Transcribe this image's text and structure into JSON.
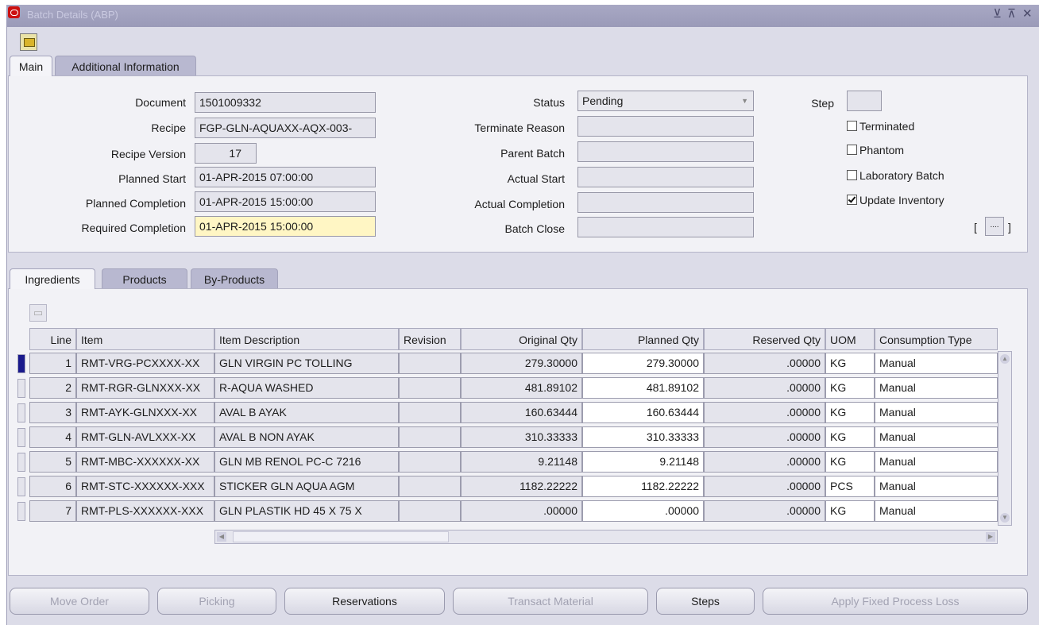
{
  "window": {
    "title": "Batch Details (ABP)",
    "controls": [
      "⊻",
      "⊼",
      "✕"
    ]
  },
  "top_tabs": [
    "Main",
    "Additional Information"
  ],
  "header": {
    "document_label": "Document",
    "document_value": "1501009332",
    "recipe_label": "Recipe",
    "recipe_value": "FGP-GLN-AQUAXX-AQX-003-",
    "recipe_version_label": "Recipe Version",
    "recipe_version_value": "17",
    "planned_start_label": "Planned Start",
    "planned_start_value": "01-APR-2015 07:00:00",
    "planned_completion_label": "Planned Completion",
    "planned_completion_value": "01-APR-2015 15:00:00",
    "required_completion_label": "Required Completion",
    "required_completion_value": "01-APR-2015 15:00:00",
    "status_label": "Status",
    "status_value": "Pending",
    "terminate_reason_label": "Terminate Reason",
    "terminate_reason_value": "",
    "parent_batch_label": "Parent Batch",
    "parent_batch_value": "",
    "actual_start_label": "Actual Start",
    "actual_start_value": "",
    "actual_completion_label": "Actual Completion",
    "actual_completion_value": "",
    "batch_close_label": "Batch Close",
    "batch_close_value": "",
    "step_label": "Step",
    "step_value": "",
    "terminated_label": "Terminated",
    "terminated_checked": false,
    "phantom_label": "Phantom",
    "phantom_checked": false,
    "laboratory_batch_label": "Laboratory Batch",
    "laboratory_batch_checked": false,
    "update_inventory_label": "Update Inventory",
    "update_inventory_checked": true,
    "descflex_open": "[",
    "descflex_value": "....",
    "descflex_close": "]"
  },
  "lower_tabs": [
    "Ingredients",
    "Products",
    "By-Products"
  ],
  "table": {
    "columns": [
      "Line",
      "Item",
      "Item Description",
      "Revision",
      "Original Qty",
      "Planned Qty",
      "Reserved Qty",
      "UOM",
      "Consumption Type"
    ],
    "rows": [
      {
        "line": "1",
        "item": "RMT-VRG-PCXXXX-XX",
        "desc": "GLN VIRGIN PC TOLLING",
        "revision": "",
        "original": "279.30000",
        "planned": "279.30000",
        "reserved": ".00000",
        "uom": "KG",
        "consumption": "Manual"
      },
      {
        "line": "2",
        "item": "RMT-RGR-GLNXXX-XX",
        "desc": "R-AQUA WASHED",
        "revision": "",
        "original": "481.89102",
        "planned": "481.89102",
        "reserved": ".00000",
        "uom": "KG",
        "consumption": "Manual"
      },
      {
        "line": "3",
        "item": "RMT-AYK-GLNXXX-XX",
        "desc": "AVAL B AYAK",
        "revision": "",
        "original": "160.63444",
        "planned": "160.63444",
        "reserved": ".00000",
        "uom": "KG",
        "consumption": "Manual"
      },
      {
        "line": "4",
        "item": "RMT-GLN-AVLXXX-XX",
        "desc": "AVAL B NON AYAK",
        "revision": "",
        "original": "310.33333",
        "planned": "310.33333",
        "reserved": ".00000",
        "uom": "KG",
        "consumption": "Manual"
      },
      {
        "line": "5",
        "item": "RMT-MBC-XXXXXX-XX",
        "desc": "GLN MB RENOL PC-C 7216",
        "revision": "",
        "original": "9.21148",
        "planned": "9.21148",
        "reserved": ".00000",
        "uom": "KG",
        "consumption": "Manual"
      },
      {
        "line": "6",
        "item": "RMT-STC-XXXXXX-XXX",
        "desc": "STICKER GLN AQUA AGM",
        "revision": "",
        "original": "1182.22222",
        "planned": "1182.22222",
        "reserved": ".00000",
        "uom": "PCS",
        "consumption": "Manual"
      },
      {
        "line": "7",
        "item": "RMT-PLS-XXXXXX-XXX",
        "desc": "GLN PLASTIK HD 45 X 75 X",
        "revision": "",
        "original": ".00000",
        "planned": ".00000",
        "reserved": ".00000",
        "uom": "KG",
        "consumption": "Manual"
      }
    ]
  },
  "buttons": {
    "move_order": "Move Order",
    "picking": "Picking",
    "reservations": "Reservations",
    "transact_material": "Transact Material",
    "steps": "Steps",
    "apply_fixed_process_loss": "Apply Fixed Process Loss"
  },
  "colors": {
    "title_bar": "#9a9ab8",
    "required_field": "#fff6c4",
    "frame": "#dcdce8"
  },
  "icons": [
    "oracle-logo-icon",
    "open-folder-icon",
    "row-indicator-icon"
  ]
}
